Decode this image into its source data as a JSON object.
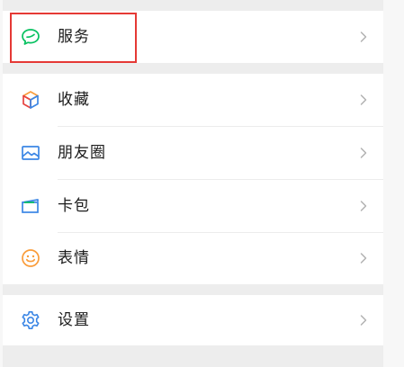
{
  "colors": {
    "background": "#f7f7f7",
    "separator": "#ededed",
    "highlight": "#e53935",
    "services_icon": "#07c160",
    "favorites_icon": "#fa9d3b",
    "moments_icon": "#3b86e5",
    "cards_icon": "#3b86e5",
    "stickers_icon": "#fa9d3b",
    "settings_icon": "#3b86e5"
  },
  "menu": {
    "services": {
      "label": "服务",
      "icon": "chat-bubble-icon"
    },
    "favorites": {
      "label": "收藏",
      "icon": "cube-icon"
    },
    "moments": {
      "label": "朋友圈",
      "icon": "image-icon"
    },
    "cards": {
      "label": "卡包",
      "icon": "card-wallet-icon"
    },
    "stickers": {
      "label": "表情",
      "icon": "smiley-icon"
    },
    "settings": {
      "label": "设置",
      "icon": "gear-icon"
    }
  }
}
